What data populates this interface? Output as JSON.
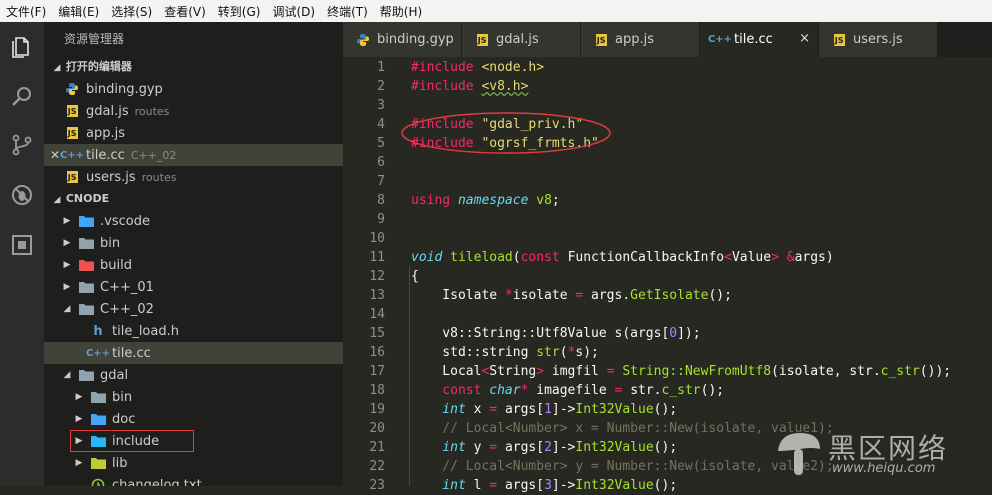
{
  "menu": [
    "文件(F)",
    "编辑(E)",
    "选择(S)",
    "查看(V)",
    "转到(G)",
    "调试(D)",
    "终端(T)",
    "帮助(H)"
  ],
  "activity_icons": [
    "files-icon",
    "search-icon",
    "source-control-icon",
    "debug-icon",
    "extensions-icon"
  ],
  "sidebar": {
    "title": "资源管理器",
    "open_editors": {
      "label": "打开的编辑器",
      "items": [
        {
          "name": "binding.gyp",
          "desc": "",
          "icon": "python-icon",
          "selected": false,
          "close": false
        },
        {
          "name": "gdal.js",
          "desc": "routes",
          "icon": "js-icon",
          "selected": false,
          "close": false
        },
        {
          "name": "app.js",
          "desc": "",
          "icon": "js-icon",
          "selected": false,
          "close": false
        },
        {
          "name": "tile.cc",
          "desc": "C++_02",
          "icon": "cpp-icon",
          "selected": true,
          "close": true
        },
        {
          "name": "users.js",
          "desc": "routes",
          "icon": "js-icon",
          "selected": false,
          "close": false
        }
      ]
    },
    "project": {
      "label": "CNODE",
      "items": [
        {
          "name": ".vscode",
          "depth": 0,
          "arrow": "▶",
          "icon": "vscode-folder-icon",
          "selected": false,
          "highlight": false
        },
        {
          "name": "bin",
          "depth": 0,
          "arrow": "▶",
          "icon": "folder-icon",
          "selected": false,
          "highlight": false
        },
        {
          "name": "build",
          "depth": 0,
          "arrow": "▶",
          "icon": "build-folder-icon",
          "selected": false,
          "highlight": false
        },
        {
          "name": "C++_01",
          "depth": 0,
          "arrow": "▶",
          "icon": "folder-icon",
          "selected": false,
          "highlight": false
        },
        {
          "name": "C++_02",
          "depth": 0,
          "arrow": "◢",
          "icon": "folder-open-icon",
          "selected": false,
          "highlight": false
        },
        {
          "name": "tile_load.h",
          "depth": 1,
          "arrow": "",
          "icon": "header-file-icon",
          "selected": false,
          "highlight": false
        },
        {
          "name": "tile.cc",
          "depth": 1,
          "arrow": "",
          "icon": "cpp-icon",
          "selected": true,
          "highlight": false
        },
        {
          "name": "gdal",
          "depth": 0,
          "arrow": "◢",
          "icon": "folder-open-icon",
          "selected": false,
          "highlight": false
        },
        {
          "name": "bin",
          "depth": 1,
          "arrow": "▶",
          "icon": "folder-icon",
          "selected": false,
          "highlight": false
        },
        {
          "name": "doc",
          "depth": 1,
          "arrow": "▶",
          "icon": "doc-folder-icon",
          "selected": false,
          "highlight": false
        },
        {
          "name": "include",
          "depth": 1,
          "arrow": "▶",
          "icon": "include-folder-icon",
          "selected": false,
          "highlight": true
        },
        {
          "name": "lib",
          "depth": 1,
          "arrow": "▶",
          "icon": "lib-folder-icon",
          "selected": false,
          "highlight": false
        },
        {
          "name": "changelog.txt",
          "depth": 1,
          "arrow": "",
          "icon": "changelog-icon",
          "selected": false,
          "highlight": false
        }
      ]
    }
  },
  "tabs": [
    {
      "label": "binding.gyp",
      "icon": "python-icon",
      "active": false
    },
    {
      "label": "gdal.js",
      "icon": "js-icon",
      "active": false
    },
    {
      "label": "app.js",
      "icon": "js-icon",
      "active": false
    },
    {
      "label": "tile.cc",
      "icon": "cpp-icon",
      "active": true
    },
    {
      "label": "users.js",
      "icon": "js-icon",
      "active": false
    }
  ],
  "tab_close": "×",
  "code_lines": [
    [
      [
        "kw",
        "#include "
      ],
      [
        "str",
        "<node.h>"
      ]
    ],
    [
      [
        "kw",
        "#include "
      ],
      [
        "str ul",
        "<v8.h>"
      ]
    ],
    [],
    [
      [
        "kw",
        "#include "
      ],
      [
        "str",
        "\"gdal_priv.h\""
      ]
    ],
    [
      [
        "kw",
        "#include "
      ],
      [
        "str",
        "\"ogrsf_frmts.h\""
      ]
    ],
    [],
    [],
    [
      [
        "kw",
        "using "
      ],
      [
        "typ",
        "namespace "
      ],
      [
        "fn",
        "v8"
      ],
      [
        "",
        "; "
      ]
    ],
    [],
    [],
    [
      [
        "typ",
        "void "
      ],
      [
        "fn",
        "tileload"
      ],
      [
        "",
        "("
      ],
      [
        "kw",
        "const "
      ],
      [
        "",
        "FunctionCallbackInfo"
      ],
      [
        "kw",
        "<"
      ],
      [
        "",
        "Value"
      ],
      [
        "kw",
        "> &"
      ],
      [
        "",
        "args)"
      ]
    ],
    [
      [
        "",
        "{"
      ]
    ],
    [
      [
        "",
        "    Isolate "
      ],
      [
        "kw",
        "*"
      ],
      [
        "",
        "isolate "
      ],
      [
        "kw",
        "= "
      ],
      [
        "",
        "args."
      ],
      [
        "fn",
        "GetIsolate"
      ],
      [
        "",
        "();"
      ]
    ],
    [],
    [
      [
        "",
        "    v8::String::Utf8Value s(args["
      ],
      [
        "num",
        "0"
      ],
      [
        "",
        "]);"
      ]
    ],
    [
      [
        "",
        "    std::string "
      ],
      [
        "fn",
        "str"
      ],
      [
        "",
        "("
      ],
      [
        "kw",
        "*"
      ],
      [
        "",
        "s);"
      ]
    ],
    [
      [
        "",
        "    Local"
      ],
      [
        "kw",
        "<"
      ],
      [
        "",
        "String"
      ],
      [
        "kw",
        "> "
      ],
      [
        "",
        "imgfil "
      ],
      [
        "kw",
        "= "
      ],
      [
        "fn",
        "String::NewFromUtf8"
      ],
      [
        "",
        "(isolate, str."
      ],
      [
        "fn",
        "c_str"
      ],
      [
        "",
        "());"
      ]
    ],
    [
      [
        "kw",
        "    const "
      ],
      [
        "typ",
        "char"
      ],
      [
        "kw",
        "* "
      ],
      [
        "",
        "imagefile "
      ],
      [
        "kw",
        "= "
      ],
      [
        "",
        "str."
      ],
      [
        "fn",
        "c_str"
      ],
      [
        "",
        "();"
      ]
    ],
    [
      [
        "typ",
        "    int "
      ],
      [
        "",
        "x "
      ],
      [
        "kw",
        "= "
      ],
      [
        "",
        "args["
      ],
      [
        "num",
        "1"
      ],
      [
        "",
        "]->"
      ],
      [
        "fn",
        "Int32Value"
      ],
      [
        "",
        "();"
      ]
    ],
    [
      [
        "cmt",
        "    // Local<Number> x = Number::New(isolate, value1);"
      ]
    ],
    [
      [
        "typ",
        "    int "
      ],
      [
        "",
        "y "
      ],
      [
        "kw",
        "= "
      ],
      [
        "",
        "args["
      ],
      [
        "num",
        "2"
      ],
      [
        "",
        "]->"
      ],
      [
        "fn",
        "Int32Value"
      ],
      [
        "",
        "();"
      ]
    ],
    [
      [
        "cmt",
        "    // Local<Number> y = Number::New(isolate, value2);"
      ]
    ],
    [
      [
        "typ",
        "    int "
      ],
      [
        "",
        "l "
      ],
      [
        "kw",
        "= "
      ],
      [
        "",
        "args["
      ],
      [
        "num",
        "3"
      ],
      [
        "",
        "]->"
      ],
      [
        "fn",
        "Int32Value"
      ],
      [
        "",
        "();"
      ]
    ]
  ],
  "watermark": {
    "text": "黑区网络",
    "url": "www.heiqu.com"
  },
  "colors": {
    "annotation_red": "#e23a3a"
  }
}
